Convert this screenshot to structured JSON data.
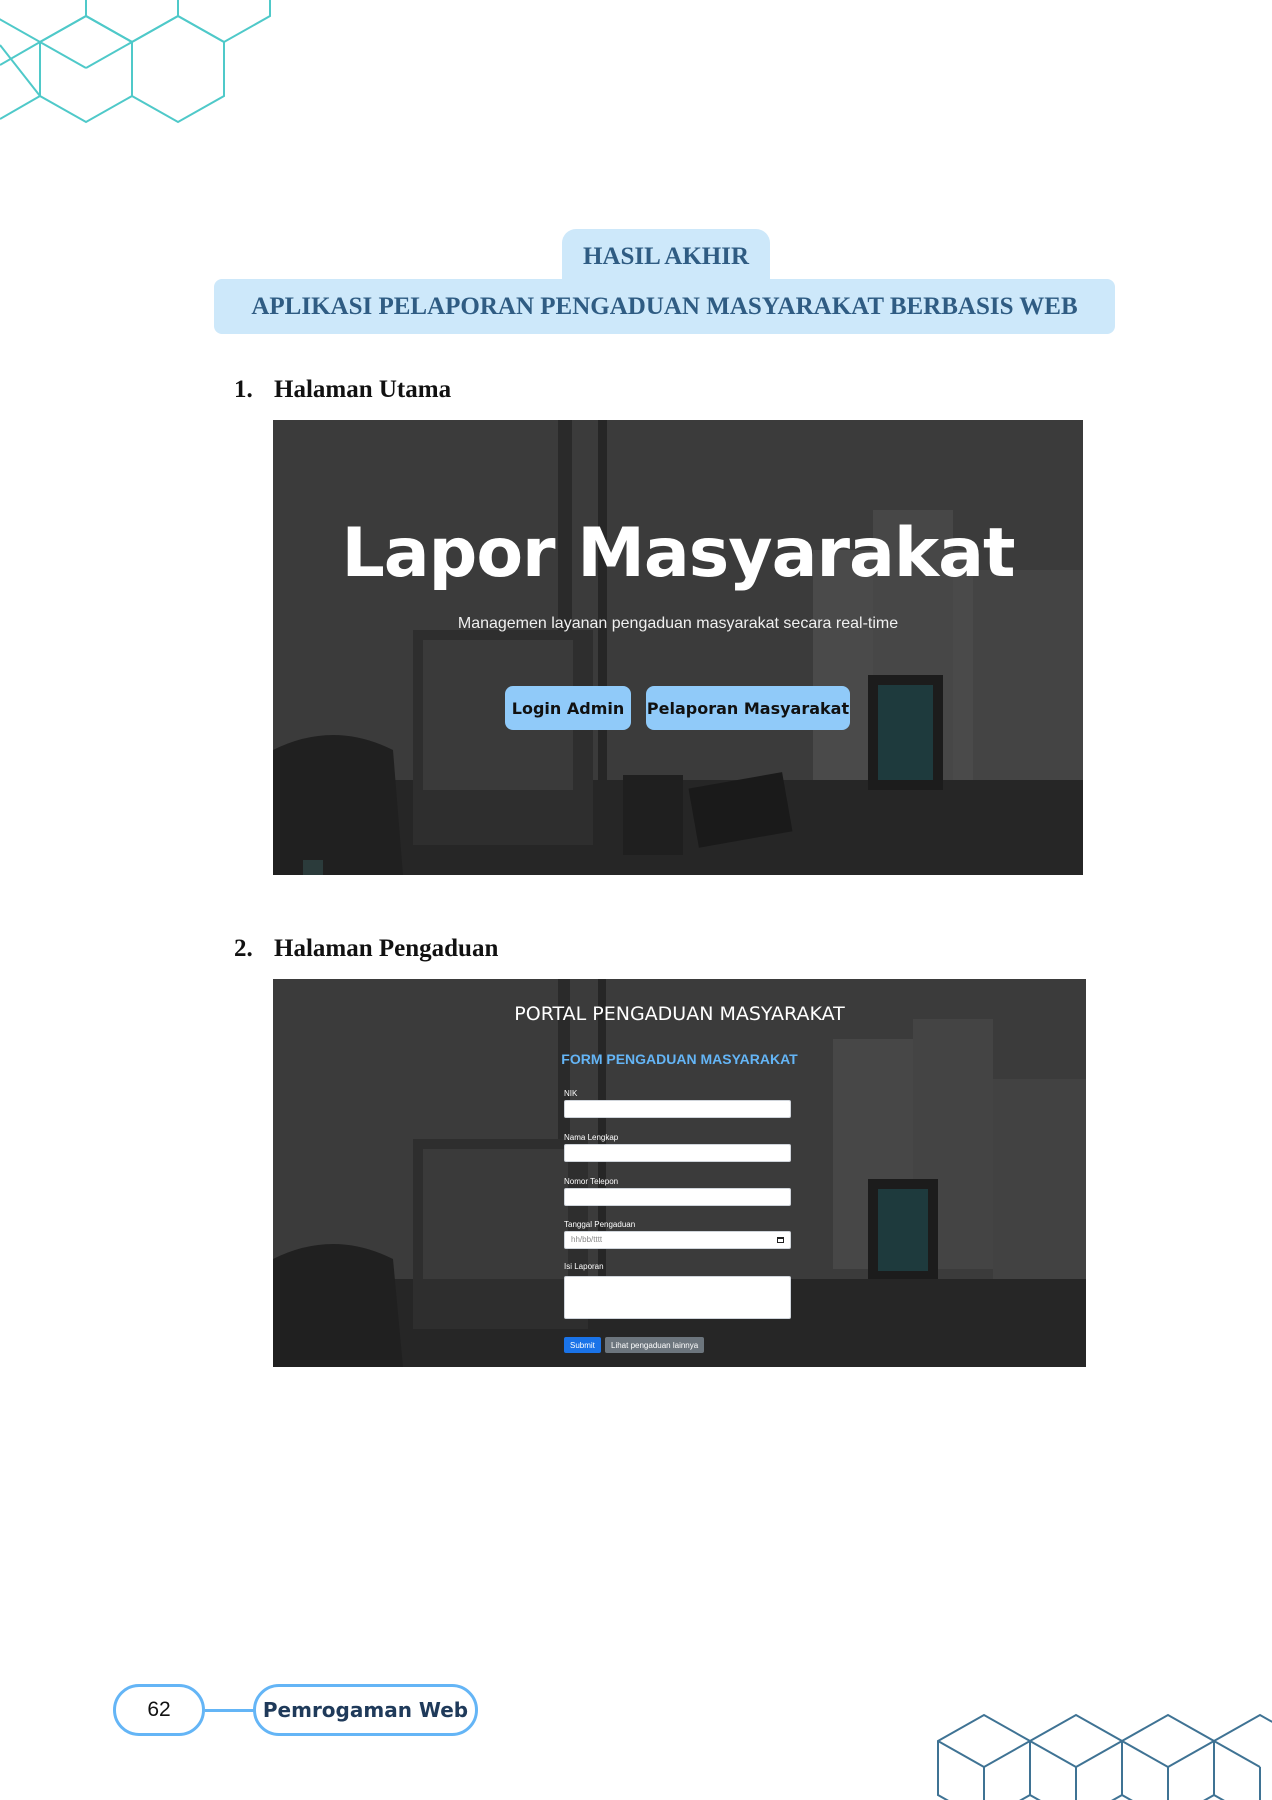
{
  "header": {
    "tab_label": "HASIL AKHIR",
    "banner_title": "APLIKASI PELAPORAN PENGADUAN MASYARAKAT BERBASIS WEB"
  },
  "sections": [
    {
      "number": "1.",
      "title": "Halaman Utama"
    },
    {
      "number": "2.",
      "title": "Halaman Pengaduan"
    }
  ],
  "home_screenshot": {
    "title": "Lapor Masyarakat",
    "subtitle": "Managemen layanan pengaduan masyarakat secara real-time",
    "buttons": {
      "login_admin": "Login Admin",
      "pelaporan": "Pelaporan Masyarakat"
    },
    "button_color": "#90caf9"
  },
  "form_screenshot": {
    "portal_title": "PORTAL PENGADUAN MASYARAKAT",
    "form_title": "FORM PENGADUAN MASYARAKAT",
    "fields": {
      "nik": "NIK",
      "nama": "Nama Lengkap",
      "telepon": "Nomor Telepon",
      "tanggal": "Tanggal Pengaduan",
      "isi": "Isi Laporan"
    },
    "date_placeholder": "hh/bb/tttt",
    "buttons": {
      "submit": "Submit",
      "lihat": "Lihat pengaduan lainnya"
    },
    "accent_color": "#64b5f6",
    "submit_color": "#1a73e8"
  },
  "footer": {
    "page_number": "62",
    "book_title": "Pemrogaman Web"
  },
  "colors": {
    "banner_bg": "#cde8fa",
    "banner_text": "#2f5c83",
    "footer_border": "#64b5f6"
  }
}
